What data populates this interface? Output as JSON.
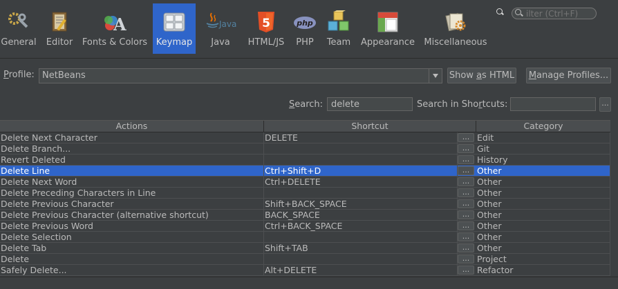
{
  "categories": [
    {
      "label": "General",
      "icon": "general-icon"
    },
    {
      "label": "Editor",
      "icon": "editor-icon"
    },
    {
      "label": "Fonts & Colors",
      "icon": "fonts-colors-icon"
    },
    {
      "label": "Keymap",
      "icon": "keymap-icon",
      "selected": true
    },
    {
      "label": "Java",
      "icon": "java-icon"
    },
    {
      "label": "HTML/JS",
      "icon": "html5-icon"
    },
    {
      "label": "PHP",
      "icon": "php-icon"
    },
    {
      "label": "Team",
      "icon": "team-icon"
    },
    {
      "label": "Appearance",
      "icon": "appearance-icon"
    },
    {
      "label": "Miscellaneous",
      "icon": "miscellaneous-icon"
    }
  ],
  "filter": {
    "placeholder": "ilter (Ctrl+F)"
  },
  "profile": {
    "label": "Profile:",
    "value": "NetBeans",
    "show_as_html": "Show as HTML",
    "manage_profiles": "Manage Profiles..."
  },
  "search": {
    "label": "Search:",
    "value": "delete",
    "shortcuts_label": "Search in Shortcuts:",
    "shortcuts_value": "",
    "dots": "..."
  },
  "table": {
    "headers": [
      "Actions",
      "Shortcut",
      "Category"
    ],
    "rows": [
      {
        "action": "Delete Next Character",
        "shortcut": "DELETE",
        "category": "Edit"
      },
      {
        "action": "Delete Branch...",
        "shortcut": "",
        "category": "Git"
      },
      {
        "action": "Revert Deleted",
        "shortcut": "",
        "category": "History"
      },
      {
        "action": "Delete Line",
        "shortcut": "Ctrl+Shift+D",
        "category": "Other",
        "selected": true
      },
      {
        "action": "Delete Next Word",
        "shortcut": "Ctrl+DELETE",
        "category": "Other"
      },
      {
        "action": "Delete Preceding Characters in Line",
        "shortcut": "",
        "category": "Other"
      },
      {
        "action": "Delete Previous Character",
        "shortcut": "Shift+BACK_SPACE",
        "category": "Other"
      },
      {
        "action": "Delete Previous Character (alternative shortcut)",
        "shortcut": "BACK_SPACE",
        "category": "Other"
      },
      {
        "action": "Delete Previous Word",
        "shortcut": "Ctrl+BACK_SPACE",
        "category": "Other"
      },
      {
        "action": "Delete Selection",
        "shortcut": "",
        "category": "Other"
      },
      {
        "action": "Delete Tab",
        "shortcut": "Shift+TAB",
        "category": "Other"
      },
      {
        "action": "Delete",
        "shortcut": "",
        "category": "Project"
      },
      {
        "action": "Safely Delete...",
        "shortcut": "Alt+DELETE",
        "category": "Refactor"
      }
    ]
  },
  "colors": {
    "background": "#3c3f41",
    "selection": "#2f65ca",
    "text": "#bbbbbb"
  }
}
